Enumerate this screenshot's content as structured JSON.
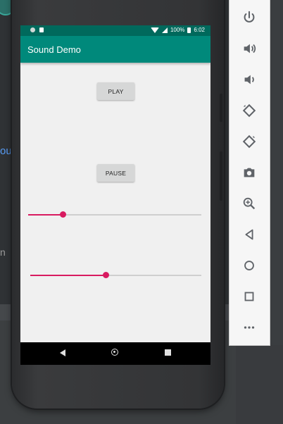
{
  "background_ide": {
    "fragment_ou": "ou",
    "fragment_n": "n"
  },
  "status_bar": {
    "battery_percent": "100%",
    "time": "6:02"
  },
  "app": {
    "title": "Sound Demo"
  },
  "buttons": {
    "play": "PLAY",
    "pause": "PAUSE"
  },
  "sliders": [
    {
      "name": "volume-seekbar",
      "fraction": 0.2
    },
    {
      "name": "progress-seekbar",
      "fraction": 0.44
    }
  ],
  "emulator_toolbar": {
    "tools": [
      "power-icon",
      "volume-up-icon",
      "volume-down-icon",
      "rotate-left-icon",
      "rotate-right-icon",
      "camera-icon",
      "zoom-icon",
      "back-icon",
      "home-icon",
      "overview-icon",
      "more-icon"
    ]
  },
  "colors": {
    "status_bar": "#00695c",
    "app_bar": "#00897b",
    "accent": "#d81b60",
    "screen_bg": "#f0f0f0"
  }
}
